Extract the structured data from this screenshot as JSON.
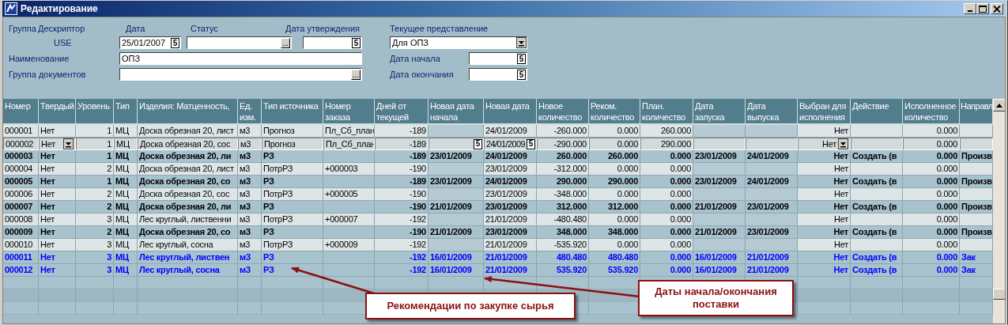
{
  "window": {
    "title": "Редактирование"
  },
  "form": {
    "labels": [
      "Группа",
      "Дескриптор",
      "Дата",
      "Статус",
      "Дата утверждения",
      "Текущее представление"
    ],
    "descriptor": "USE",
    "date": {
      "value": "25/01/2007",
      "button": "5"
    },
    "status": {
      "button": "..."
    },
    "approval_date": {
      "button": "5"
    },
    "view": {
      "value": "Для ОПЗ"
    },
    "name_label": "Наименование",
    "name": {
      "value": "ОПЗ"
    },
    "doc_group_label": "Группа документов",
    "doc_group": {
      "button": "..."
    },
    "start_label": "Дата начала",
    "start_date": {
      "button": "5"
    },
    "end_label": "Дата окончания",
    "end_date": {
      "button": "5"
    }
  },
  "table": {
    "columns": [
      {
        "label": "Номер"
      },
      {
        "label": "Твердый"
      },
      {
        "label": "Уровень"
      },
      {
        "label": "Тип"
      },
      {
        "label": "Изделия: Матценность,"
      },
      {
        "label": "Ед. изм."
      },
      {
        "label": "Тип источника"
      },
      {
        "label": "Номер заказа"
      },
      {
        "label": "Дней от текущей"
      },
      {
        "label": "Новая дата начала"
      },
      {
        "label": "Новая дата"
      },
      {
        "label": "Новое количество"
      },
      {
        "label": "Реком. количество"
      },
      {
        "label": "План. количество"
      },
      {
        "label": "Дата запуска"
      },
      {
        "label": "Дата выпуска"
      },
      {
        "label": "Выбран для исполнения"
      },
      {
        "label": "Действие"
      },
      {
        "label": "Исполненное количество"
      },
      {
        "label": "Направл"
      }
    ],
    "rows": [
      {
        "kind": "normal",
        "selected": false,
        "cells": [
          "000001",
          "Нет",
          "1",
          "МЦ",
          "Доска обрезная 20, лист",
          "м3",
          "Прогноз",
          "Пл_Сб_план",
          "-189",
          null,
          "24/01/2009",
          "-260.000",
          "0.000",
          "260.000",
          null,
          null,
          "Нет",
          null,
          "0.000",
          null
        ]
      },
      {
        "kind": "normal",
        "selected": true,
        "cells": [
          "000002",
          {
            "text": "Нет",
            "dropdown": true
          },
          "1",
          "МЦ",
          "Доска обрезная 20, сос",
          "м3",
          "Прогноз",
          "Пл_Сб_план",
          "-189",
          {
            "button": "5"
          },
          {
            "text": "24/01/2009",
            "button": "5"
          },
          "-290.000",
          "0.000",
          "290.000",
          null,
          null,
          {
            "text": "Нет",
            "dropdown": true
          },
          null,
          "0.000",
          null
        ]
      },
      {
        "kind": "bold",
        "selected": false,
        "cells": [
          "000003",
          "Нет",
          "1",
          "МЦ",
          "Доска обрезная 20, ли",
          "м3",
          "РЗ",
          null,
          "-189",
          "23/01/2009",
          "24/01/2009",
          "260.000",
          "260.000",
          "0.000",
          "23/01/2009",
          "24/01/2009",
          "Нет",
          "Создать (в",
          "0.000",
          "Произв"
        ]
      },
      {
        "kind": "normal",
        "selected": false,
        "cells": [
          "000004",
          "Нет",
          "2",
          "МЦ",
          "Доска обрезная 20, лист",
          "м3",
          "ПотрРЗ",
          "+000003",
          "-190",
          null,
          "23/01/2009",
          "-312.000",
          "0.000",
          "0.000",
          null,
          null,
          "Нет",
          null,
          "0.000",
          null
        ]
      },
      {
        "kind": "bold",
        "selected": false,
        "cells": [
          "000005",
          "Нет",
          "1",
          "МЦ",
          "Доска обрезная 20, со",
          "м3",
          "РЗ",
          null,
          "-189",
          "23/01/2009",
          "24/01/2009",
          "290.000",
          "290.000",
          "0.000",
          "23/01/2009",
          "24/01/2009",
          "Нет",
          "Создать (в",
          "0.000",
          "Произв"
        ]
      },
      {
        "kind": "normal",
        "selected": false,
        "cells": [
          "000006",
          "Нет",
          "2",
          "МЦ",
          "Доска обрезная 20, сос",
          "м3",
          "ПотрРЗ",
          "+000005",
          "-190",
          null,
          "23/01/2009",
          "-348.000",
          "0.000",
          "0.000",
          null,
          null,
          "Нет",
          null,
          "0.000",
          null
        ]
      },
      {
        "kind": "bold",
        "selected": false,
        "cells": [
          "000007",
          "Нет",
          "2",
          "МЦ",
          "Доска обрезная 20, ли",
          "м3",
          "РЗ",
          null,
          "-190",
          "21/01/2009",
          "23/01/2009",
          "312.000",
          "312.000",
          "0.000",
          "21/01/2009",
          "23/01/2009",
          "Нет",
          "Создать (в",
          "0.000",
          "Произв"
        ]
      },
      {
        "kind": "normal",
        "selected": false,
        "cells": [
          "000008",
          "Нет",
          "3",
          "МЦ",
          "Лес круглый, лиственни",
          "м3",
          "ПотрРЗ",
          "+000007",
          "-192",
          null,
          "21/01/2009",
          "-480.480",
          "0.000",
          "0.000",
          null,
          null,
          "Нет",
          null,
          "0.000",
          null
        ]
      },
      {
        "kind": "bold",
        "selected": false,
        "cells": [
          "000009",
          "Нет",
          "2",
          "МЦ",
          "Доска обрезная 20, со",
          "м3",
          "РЗ",
          null,
          "-190",
          "21/01/2009",
          "23/01/2009",
          "348.000",
          "348.000",
          "0.000",
          "21/01/2009",
          "23/01/2009",
          "Нет",
          "Создать (в",
          "0.000",
          "Произв"
        ]
      },
      {
        "kind": "normal",
        "selected": false,
        "cells": [
          "000010",
          "Нет",
          "3",
          "МЦ",
          "Лес круглый, сосна",
          "м3",
          "ПотрРЗ",
          "+000009",
          "-192",
          null,
          "21/01/2009",
          "-535.920",
          "0.000",
          "0.000",
          null,
          null,
          "Нет",
          null,
          "0.000",
          null
        ]
      },
      {
        "kind": "blue",
        "selected": false,
        "cells": [
          "000011",
          "Нет",
          "3",
          "МЦ",
          "Лес круглый, листвен",
          "м3",
          "РЗ",
          null,
          "-192",
          "16/01/2009",
          "21/01/2009",
          "480.480",
          "480.480",
          "0.000",
          "16/01/2009",
          "21/01/2009",
          "Нет",
          "Создать (в",
          "0.000",
          "Зак"
        ]
      },
      {
        "kind": "blue",
        "selected": false,
        "cells": [
          "000012",
          "Нет",
          "3",
          "МЦ",
          "Лес круглый, сосна",
          "м3",
          "РЗ",
          null,
          "-192",
          "16/01/2009",
          "21/01/2009",
          "535.920",
          "535.920",
          "0.000",
          "16/01/2009",
          "21/01/2009",
          "Нет",
          "Создать (в",
          "0.000",
          "Зак"
        ]
      }
    ]
  },
  "callouts": [
    {
      "text": "Рекомендации по закупке сырья"
    },
    {
      "text": "Даты начала/окончания поставки"
    }
  ]
}
